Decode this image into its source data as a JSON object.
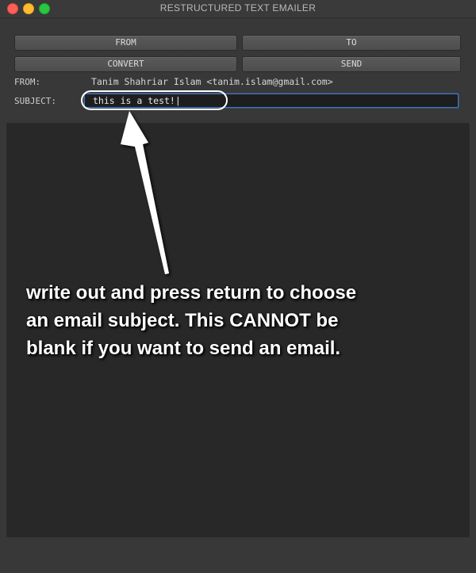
{
  "window": {
    "title": "RESTRUCTURED TEXT EMAILER"
  },
  "toolbar": {
    "from_label": "FROM",
    "to_label": "TO",
    "convert_label": "CONVERT",
    "send_label": "SEND"
  },
  "form": {
    "from_label": "FROM:",
    "from_value": "Tanim Shahriar Islam <tanim.islam@gmail.com>",
    "subject_label": "SUBJECT:",
    "subject_value": "this is a test!|"
  },
  "annotation": {
    "text": "write out and press return to choose an email subject. This CANNOT be blank if you want to send an email."
  },
  "colors": {
    "background": "#383838",
    "body_area": "#282828",
    "focus_ring": "#3c78c8",
    "close": "#fe5f57",
    "minimize": "#febc2e",
    "maximize": "#28c840"
  },
  "icons": [
    "close-button-icon",
    "minimize-button-icon",
    "maximize-button-icon",
    "arrow-annotation-icon"
  ]
}
